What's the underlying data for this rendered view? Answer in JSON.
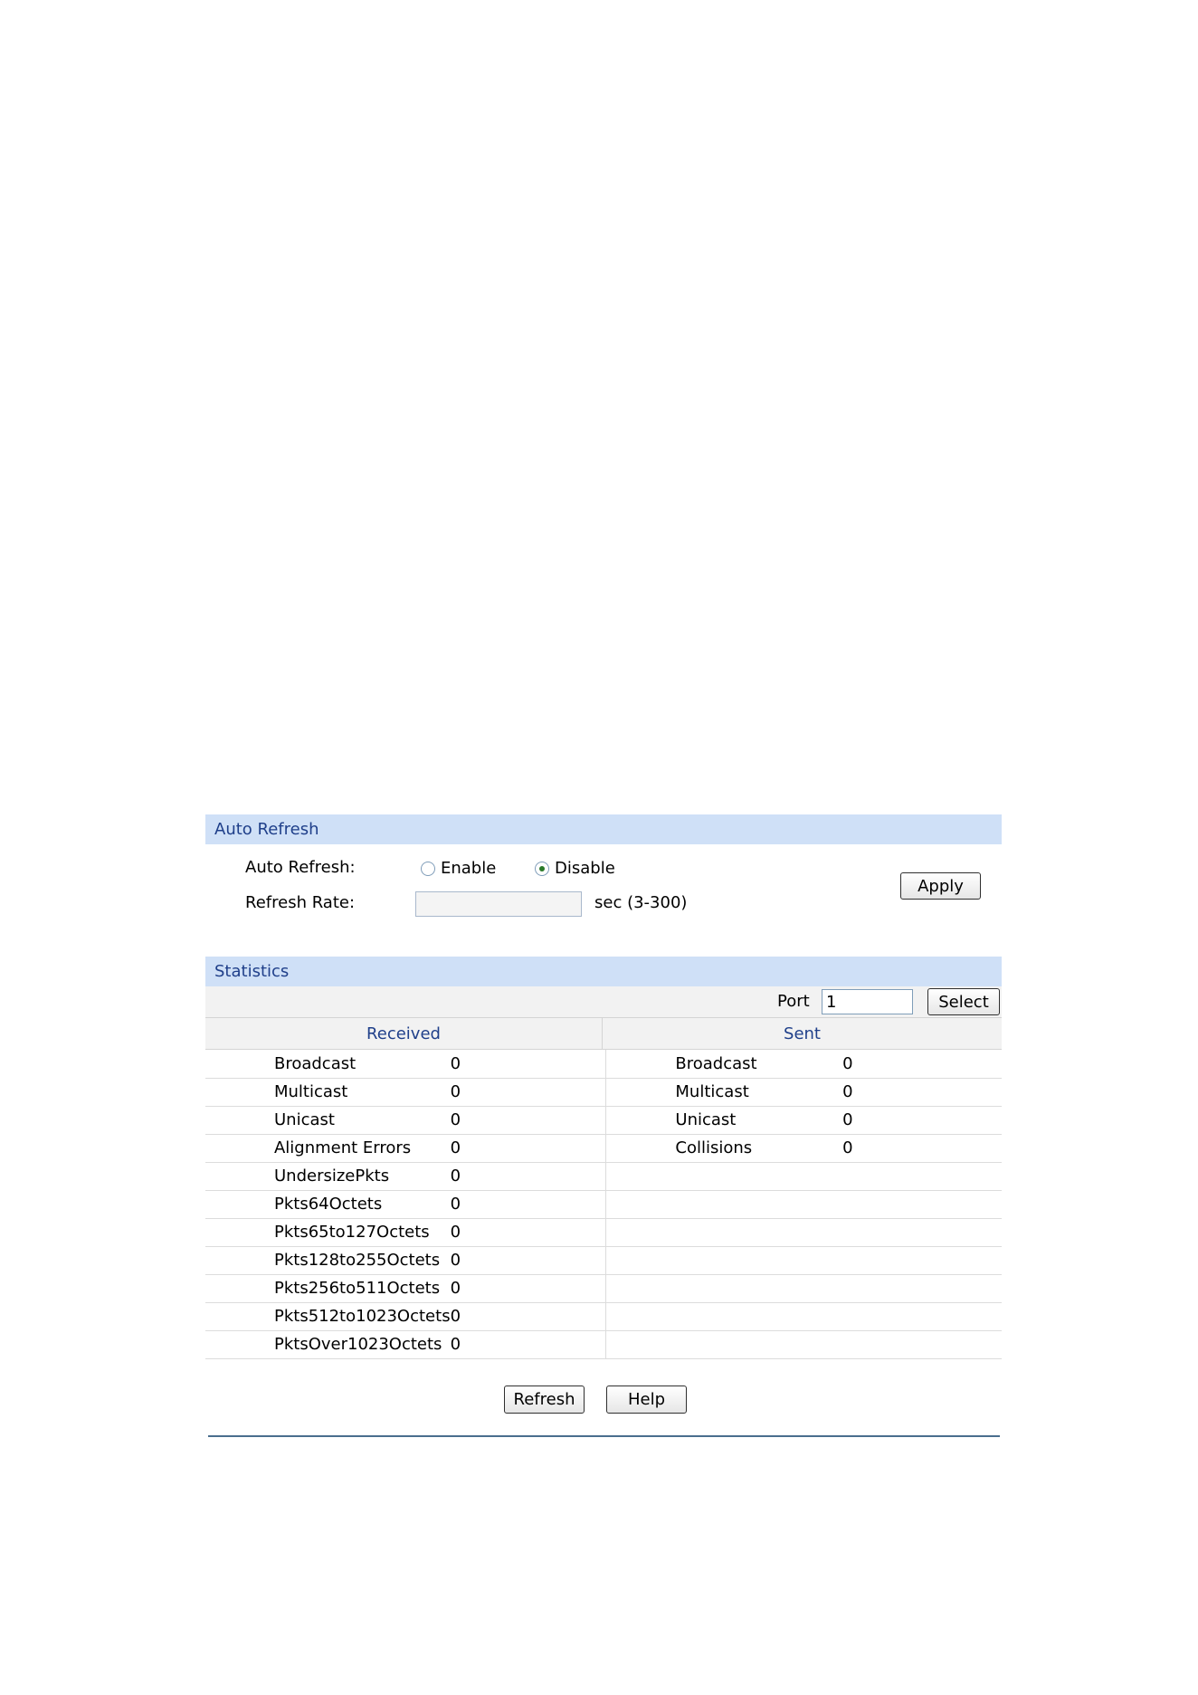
{
  "auto_refresh": {
    "header": "Auto Refresh",
    "label": "Auto Refresh:",
    "enable_label": "Enable",
    "disable_label": "Disable",
    "selected": "Disable",
    "rate_label": "Refresh Rate:",
    "rate_value": "",
    "rate_hint": "sec (3-300)",
    "apply_label": "Apply"
  },
  "statistics": {
    "header": "Statistics",
    "port_label": "Port",
    "port_value": "1",
    "select_label": "Select",
    "received_header": "Received",
    "sent_header": "Sent",
    "rows": [
      {
        "rx_name": "Broadcast",
        "rx_value": "0",
        "tx_name": "Broadcast",
        "tx_value": "0"
      },
      {
        "rx_name": "Multicast",
        "rx_value": "0",
        "tx_name": "Multicast",
        "tx_value": "0"
      },
      {
        "rx_name": "Unicast",
        "rx_value": "0",
        "tx_name": "Unicast",
        "tx_value": "0"
      },
      {
        "rx_name": "Alignment Errors",
        "rx_value": "0",
        "tx_name": "Collisions",
        "tx_value": "0"
      },
      {
        "rx_name": "UndersizePkts",
        "rx_value": "0",
        "tx_name": "",
        "tx_value": ""
      },
      {
        "rx_name": "Pkts64Octets",
        "rx_value": "0",
        "tx_name": "",
        "tx_value": ""
      },
      {
        "rx_name": "Pkts65to127Octets",
        "rx_value": "0",
        "tx_name": "",
        "tx_value": ""
      },
      {
        "rx_name": "Pkts128to255Octets",
        "rx_value": "0",
        "tx_name": "",
        "tx_value": ""
      },
      {
        "rx_name": "Pkts256to511Octets",
        "rx_value": "0",
        "tx_name": "",
        "tx_value": ""
      },
      {
        "rx_name": "Pkts512to1023Octets",
        "rx_value": "0",
        "tx_name": "",
        "tx_value": ""
      },
      {
        "rx_name": "PktsOver1023Octets",
        "rx_value": "0",
        "tx_name": "",
        "tx_value": ""
      }
    ]
  },
  "footer": {
    "refresh_label": "Refresh",
    "help_label": "Help"
  },
  "colors": {
    "header_bg": "#cfe0f7",
    "header_text": "#1f3f8a",
    "divider": "#4a6e8e"
  }
}
